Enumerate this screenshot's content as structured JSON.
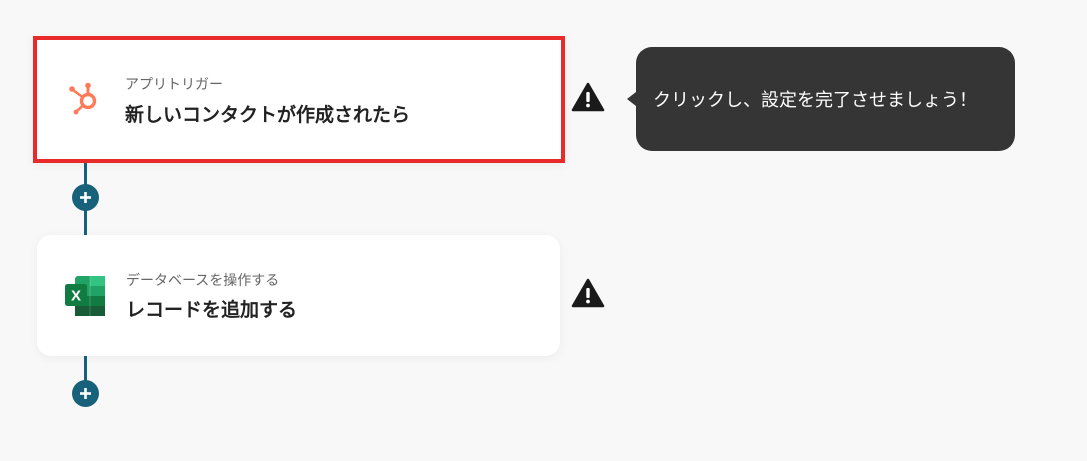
{
  "steps": [
    {
      "app": "HubSpot",
      "icon": "hubspot-icon",
      "subtitle": "アプリトリガー",
      "title": "新しいコンタクトが作成されたら",
      "highlighted": true,
      "warning": true
    },
    {
      "app": "Excel",
      "icon": "excel-icon",
      "subtitle": "データベースを操作する",
      "title": "レコードを追加する",
      "highlighted": false,
      "warning": true
    }
  ],
  "tooltip": {
    "text": "クリックし、設定を完了させましょう！"
  },
  "colors": {
    "background": "#f8f8f8",
    "connector": "#17617b",
    "highlight_border": "#e82a2a",
    "hubspot": "#ff7a59",
    "excel": "#1f7244",
    "tooltip_bg": "#353535"
  }
}
